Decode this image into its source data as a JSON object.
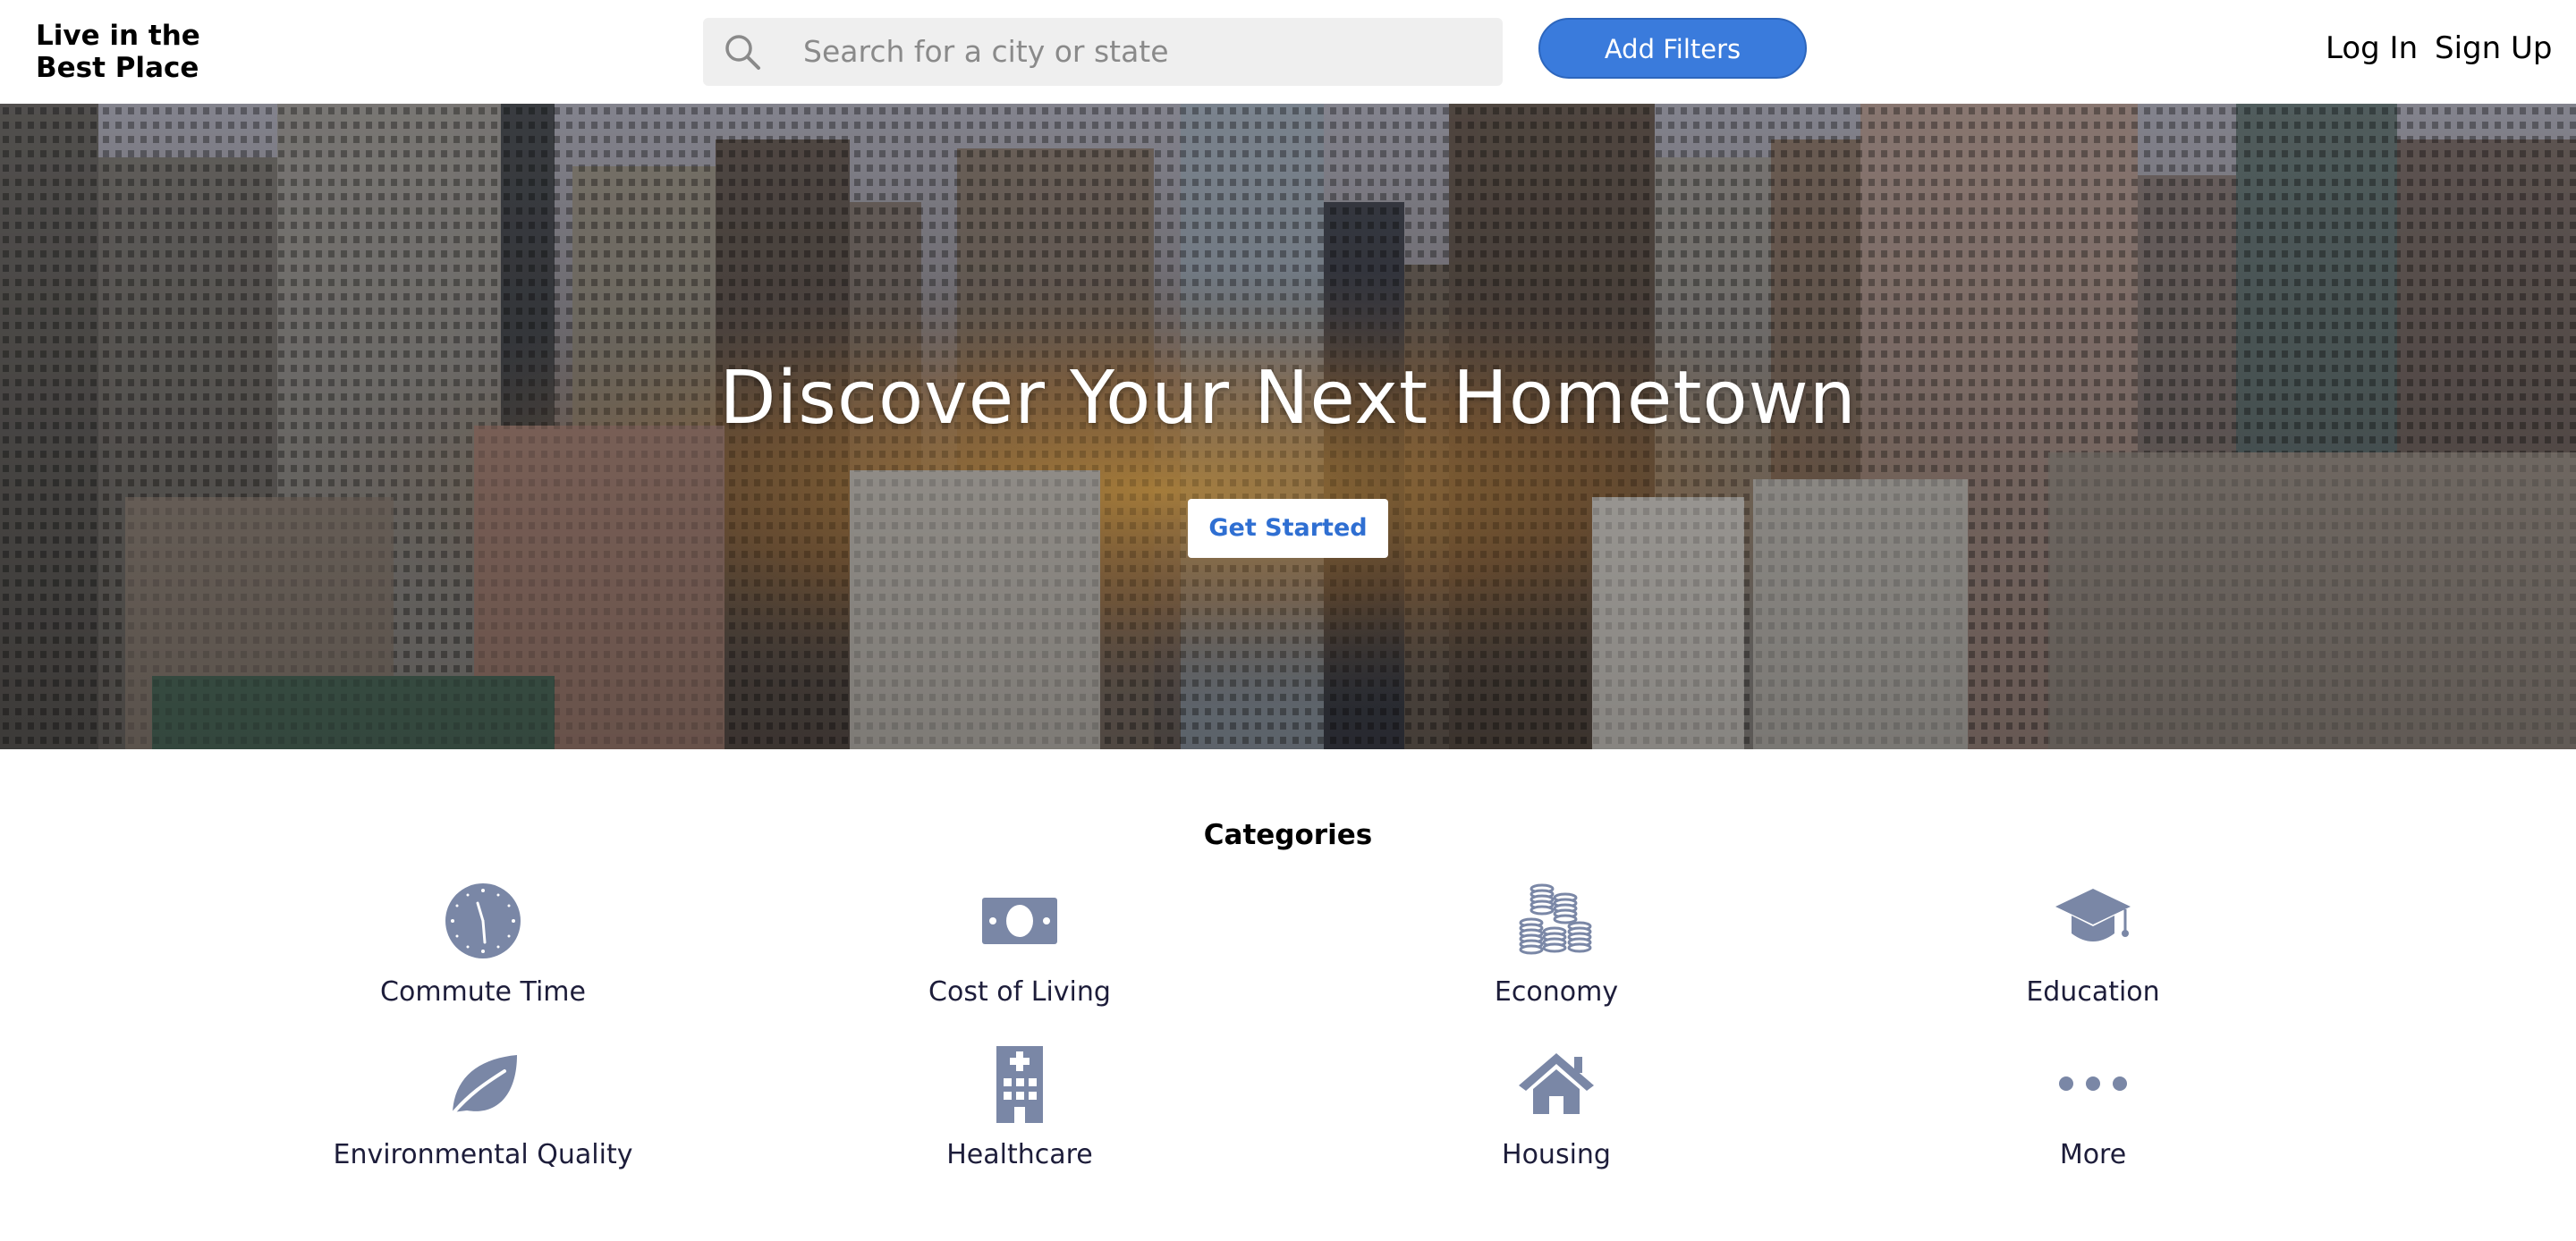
{
  "header": {
    "logo_line1": "Live in the",
    "logo_line2": "Best Place",
    "search_placeholder": "Search for a city or state",
    "filters_label": "Add Filters",
    "login_label": "Log In",
    "signup_label": "Sign Up"
  },
  "hero": {
    "title": "Discover Your Next Hometown",
    "cta_label": "Get Started"
  },
  "categories": {
    "title": "Categories",
    "items": [
      {
        "label": "Commute Time",
        "icon": "clock-icon"
      },
      {
        "label": "Cost of Living",
        "icon": "banknote-icon"
      },
      {
        "label": "Economy",
        "icon": "coins-icon"
      },
      {
        "label": "Education",
        "icon": "graduation-cap-icon"
      },
      {
        "label": "Environmental Quality",
        "icon": "leaf-icon"
      },
      {
        "label": "Healthcare",
        "icon": "hospital-icon"
      },
      {
        "label": "Housing",
        "icon": "house-icon"
      },
      {
        "label": "More",
        "icon": "more-dots-icon"
      }
    ]
  },
  "colors": {
    "accent": "#3a7bdc",
    "icon": "#7a87a6",
    "label": "#1d1d3a"
  }
}
